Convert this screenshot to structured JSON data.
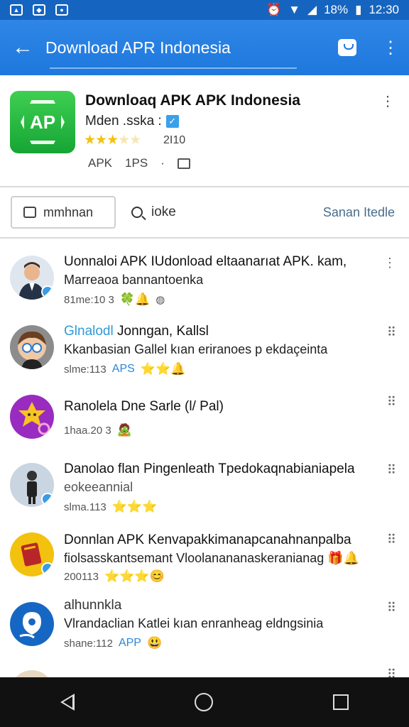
{
  "status": {
    "battery": "18%",
    "time": "12:30"
  },
  "appbar": {
    "title": "Download APR Indonesia"
  },
  "app": {
    "icon_text": "AP",
    "name": "Downloaq APK APK Indonesia",
    "developer": "Mden .sska :",
    "rating_count": "2I10",
    "meta_type": "APK",
    "meta_size": "1PS",
    "meta_dot": "·"
  },
  "filters": {
    "button": "mmhnan",
    "search": "ioke",
    "sort": "Sanan Itedle"
  },
  "items": [
    {
      "line1": "Uonnaloi APK IUdonload eltaanarıat APK. kam,",
      "line2": "Marreaoa bannantoenka",
      "meta": "81me:10 3",
      "extras": "🍀🔔"
    },
    {
      "line1_a": "Glnalodl",
      "line1_b": "Jonngan, Kallsl",
      "line2": "Kkanbasian Gallel kıan eriranoes p ekdaçeinta",
      "meta": "slme:113",
      "tag": "APS",
      "extras": "⭐⭐🔔"
    },
    {
      "line1": "Ranolela Dne Sarle (l/ Pal)",
      "meta": "1haa.20 3",
      "extras": "🧟"
    },
    {
      "line1": "Danolao flan Pingenleath Tpedokaqnabianiapela",
      "line2": "eokeeannial",
      "meta": "slma.113",
      "extras": "⭐⭐⭐"
    },
    {
      "line1": "Donnlan APK Kenvapakkimanapcanahnanpalba",
      "line2": "fiolsasskantsemant Vloolanananaskeranianag",
      "meta": "200113",
      "extras": "⭐⭐⭐😊",
      "extras2": "🎁🔔"
    },
    {
      "line1": "alhunnkla",
      "line2": "Vlrandaclian Katlei kıan enranheag eldngsinia",
      "meta": "shane:112",
      "tag": "APP",
      "extras": "😃"
    }
  ]
}
